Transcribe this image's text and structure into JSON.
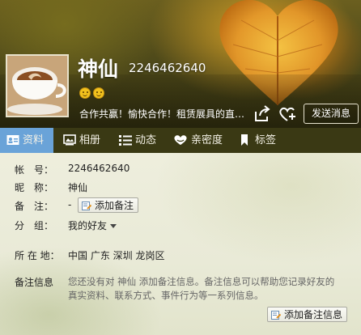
{
  "profile": {
    "name": "神仙",
    "qq_number": "2246462640",
    "signature": "合作共赢！愉快合作！租赁展具的直…",
    "send_message_label": "发送消息"
  },
  "tabs": [
    {
      "label": "资料",
      "icon": "profile-card-icon",
      "active": true
    },
    {
      "label": "相册",
      "icon": "photo-album-icon",
      "active": false
    },
    {
      "label": "动态",
      "icon": "feed-list-icon",
      "active": false
    },
    {
      "label": "亲密度",
      "icon": "heart-icon",
      "active": false
    },
    {
      "label": "标签",
      "icon": "bookmark-icon",
      "active": false
    }
  ],
  "info": {
    "account_label": "帐　号：",
    "account_value": "2246462640",
    "nickname_label": "昵　称：",
    "nickname_value": "神仙",
    "remark_label": "备　注：",
    "remark_value": "-",
    "add_remark_label": "添加备注",
    "group_label": "分　组：",
    "group_value": "我的好友",
    "location_label": "所 在 地：",
    "location_value": "中国 广东 深圳 龙岗区",
    "remark_info_label": "备注信息",
    "remark_info_text": "您还没有对 神仙 添加备注信息。备注信息可以帮助您记录好友的真实资料、联系方式、事件行为等一系列信息。",
    "add_remark_info_label": "添加备注信息"
  },
  "colors": {
    "tab_active": "#6aa3d8",
    "tab_bar": "#3a3914",
    "header_dark": "#4f4a1a"
  }
}
